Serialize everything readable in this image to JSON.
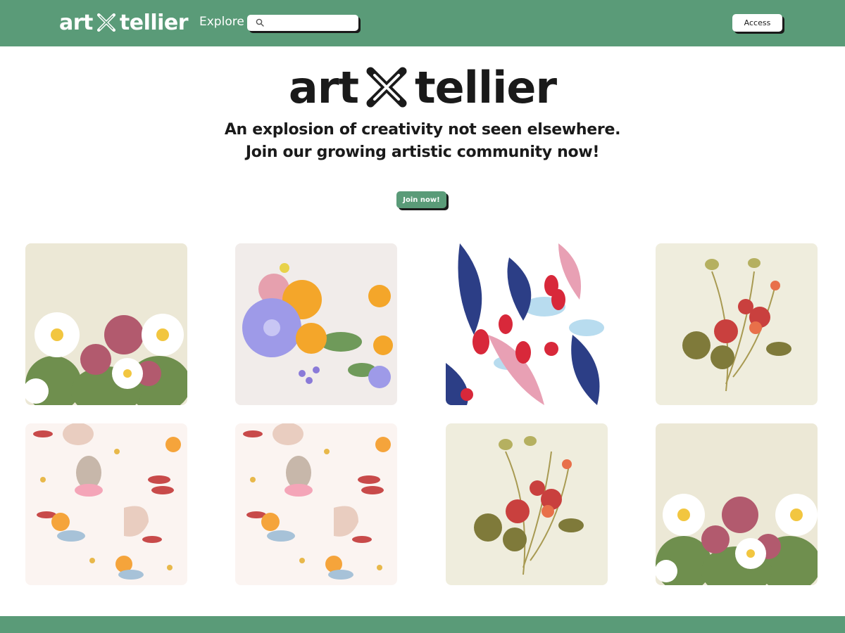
{
  "header": {
    "brand_left": "art",
    "brand_right": "tellier",
    "explore_label": "Explore",
    "search_placeholder": "",
    "access_label": "Access",
    "brand_color": "#5a9b78"
  },
  "hero": {
    "brand_left": "art",
    "brand_right": "tellier",
    "tagline_line1": "An explosion of creativity not seen elsewhere.",
    "tagline_line2": "Join our growing artistic community now!",
    "join_label": "Join now!"
  },
  "gallery": {
    "tiles": [
      {
        "icon": "daisy-meadow-artwork"
      },
      {
        "icon": "colorful-flower-bouquet-artwork"
      },
      {
        "icon": "red-blue-leaf-pattern-artwork"
      },
      {
        "icon": "nasturtium-botanical-artwork"
      },
      {
        "icon": "ballerina-animals-pattern-artwork"
      },
      {
        "icon": "ballerina-animals-pattern-artwork"
      },
      {
        "icon": "nasturtium-botanical-artwork"
      },
      {
        "icon": "daisy-meadow-artwork"
      }
    ]
  }
}
